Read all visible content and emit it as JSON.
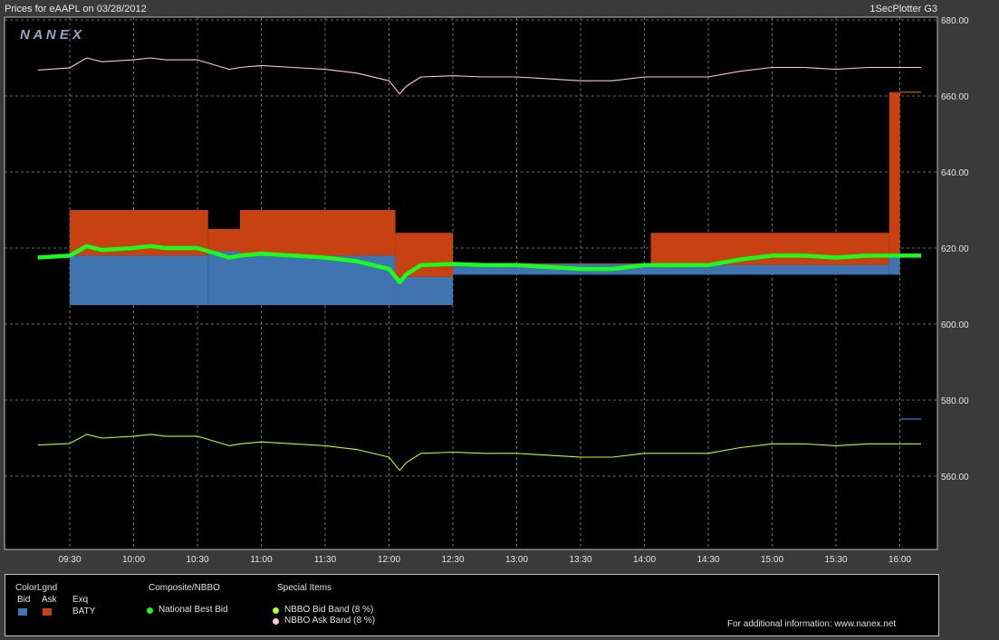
{
  "header": {
    "title": "Prices for  eAAPL  on  03/28/2012",
    "plotter": "1SecPlotter G3",
    "watermark": "N A N E X"
  },
  "chart_data": {
    "type": "line",
    "ylim": [
      545,
      683
    ],
    "y_ticks": [
      "680.00",
      "660.00",
      "640.00",
      "620.00",
      "600.00",
      "580.00",
      "560.00"
    ],
    "x_ticks": [
      "09:30",
      "10:00",
      "10:30",
      "11:00",
      "11:30",
      "12:00",
      "12:30",
      "13:00",
      "13:30",
      "14:00",
      "14:30",
      "15:00",
      "15:30",
      "16:00"
    ],
    "grid": true,
    "series": [
      {
        "name": "National Best Bid",
        "color": "#19ff1a",
        "x": [
          "09:15",
          "09:30",
          "09:38",
          "09:45",
          "10:00",
          "10:08",
          "10:15",
          "10:30",
          "10:45",
          "10:50",
          "11:00",
          "11:15",
          "11:30",
          "11:45",
          "12:00",
          "12:05",
          "12:08",
          "12:15",
          "12:30",
          "12:45",
          "13:00",
          "13:15",
          "13:30",
          "13:45",
          "14:00",
          "14:15",
          "14:30",
          "14:45",
          "15:00",
          "15:15",
          "15:30",
          "15:45",
          "16:00",
          "16:10"
        ],
        "values": [
          617.5,
          618,
          620.5,
          619.5,
          620,
          620.5,
          620,
          620,
          617.5,
          618,
          618.5,
          618,
          617.5,
          616.5,
          614.5,
          611,
          613,
          615.5,
          615.8,
          615.5,
          615.5,
          615,
          614.5,
          614.5,
          615.5,
          615.5,
          615.5,
          617,
          618,
          618,
          617.5,
          618,
          618,
          618
        ]
      },
      {
        "name": "NBBO Bid Band (8 %)",
        "color": "#b4ff2a",
        "x": [
          "09:15",
          "09:30",
          "09:38",
          "09:45",
          "10:00",
          "10:08",
          "10:15",
          "10:30",
          "10:45",
          "10:50",
          "11:00",
          "11:15",
          "11:30",
          "11:45",
          "12:00",
          "12:05",
          "12:08",
          "12:15",
          "12:30",
          "12:45",
          "13:00",
          "13:15",
          "13:30",
          "13:45",
          "14:00",
          "14:15",
          "14:30",
          "14:45",
          "15:00",
          "15:15",
          "15:30",
          "15:45",
          "16:00",
          "16:10"
        ],
        "values": [
          568.2,
          568.6,
          571,
          570,
          570.5,
          571,
          570.5,
          570.5,
          568,
          568.5,
          569,
          568.5,
          568,
          567,
          565,
          561.5,
          563.5,
          566,
          566.3,
          566,
          566,
          565.5,
          565,
          565,
          566,
          566,
          566,
          567.5,
          568.5,
          568.5,
          568,
          568.5,
          568.5,
          568.5
        ]
      },
      {
        "name": "NBBO Ask Band (8 %)",
        "color": "#ffc8c8",
        "x": [
          "09:15",
          "09:30",
          "09:38",
          "09:45",
          "10:00",
          "10:08",
          "10:15",
          "10:30",
          "10:45",
          "10:50",
          "11:00",
          "11:15",
          "11:30",
          "11:45",
          "12:00",
          "12:05",
          "12:08",
          "12:15",
          "12:30",
          "12:45",
          "13:00",
          "13:15",
          "13:30",
          "13:45",
          "14:00",
          "14:15",
          "14:30",
          "14:45",
          "15:00",
          "15:15",
          "15:30",
          "15:45",
          "16:00",
          "16:10"
        ],
        "values": [
          666.8,
          667.4,
          670,
          669,
          669.5,
          670,
          669.5,
          669.5,
          667,
          667.5,
          668,
          667.5,
          667,
          666,
          664,
          660.5,
          662.5,
          665,
          665.3,
          665,
          665,
          664.5,
          664,
          664,
          665,
          665,
          665,
          666.5,
          667.5,
          667.5,
          667,
          667.5,
          667.5,
          667.5
        ]
      }
    ],
    "bid_ask_bands": [
      {
        "start": "09:30",
        "end": "10:35",
        "bid_low": 605,
        "ask_high": 630
      },
      {
        "start": "10:35",
        "end": "10:50",
        "bid_low": 605,
        "ask_high": 625
      },
      {
        "start": "10:50",
        "end": "12:03",
        "bid_low": 605,
        "ask_high": 630
      },
      {
        "start": "12:03",
        "end": "12:30",
        "bid_low": 605,
        "ask_high": 624
      },
      {
        "start": "12:30",
        "end": "14:03",
        "bid_low": 613,
        "ask_high": 616
      },
      {
        "start": "14:03",
        "end": "15:55",
        "bid_low": 613,
        "ask_high": 624
      },
      {
        "start": "15:55",
        "end": "16:00",
        "bid_low": 613,
        "ask_high": 661
      }
    ],
    "levels": [
      {
        "name": "ask",
        "start": "16:00",
        "end": "16:10",
        "value": 661
      },
      {
        "name": "bid",
        "start": "16:00",
        "end": "16:10",
        "value": 575
      }
    ]
  },
  "legend": {
    "color_legend_title": "ColorLgnd",
    "bid_label": "Bid",
    "ask_label": "Ask",
    "exch_label": "Exq",
    "exch_value": "BATY",
    "composite_title": "Composite/NBBO",
    "nbb_label": "National Best Bid",
    "special_title": "Special Items",
    "bid_band_label": "NBBO Bid Band (8 %)",
    "ask_band_label": "NBBO Ask Band (8 %)",
    "footer": "For additional information: www.nanex.net",
    "colors": {
      "bid": "#3f74b0",
      "ask": "#c84112",
      "nbb": "#19ff1a",
      "bid_band": "#b4ff2a",
      "ask_band": "#ffc8c8"
    }
  }
}
